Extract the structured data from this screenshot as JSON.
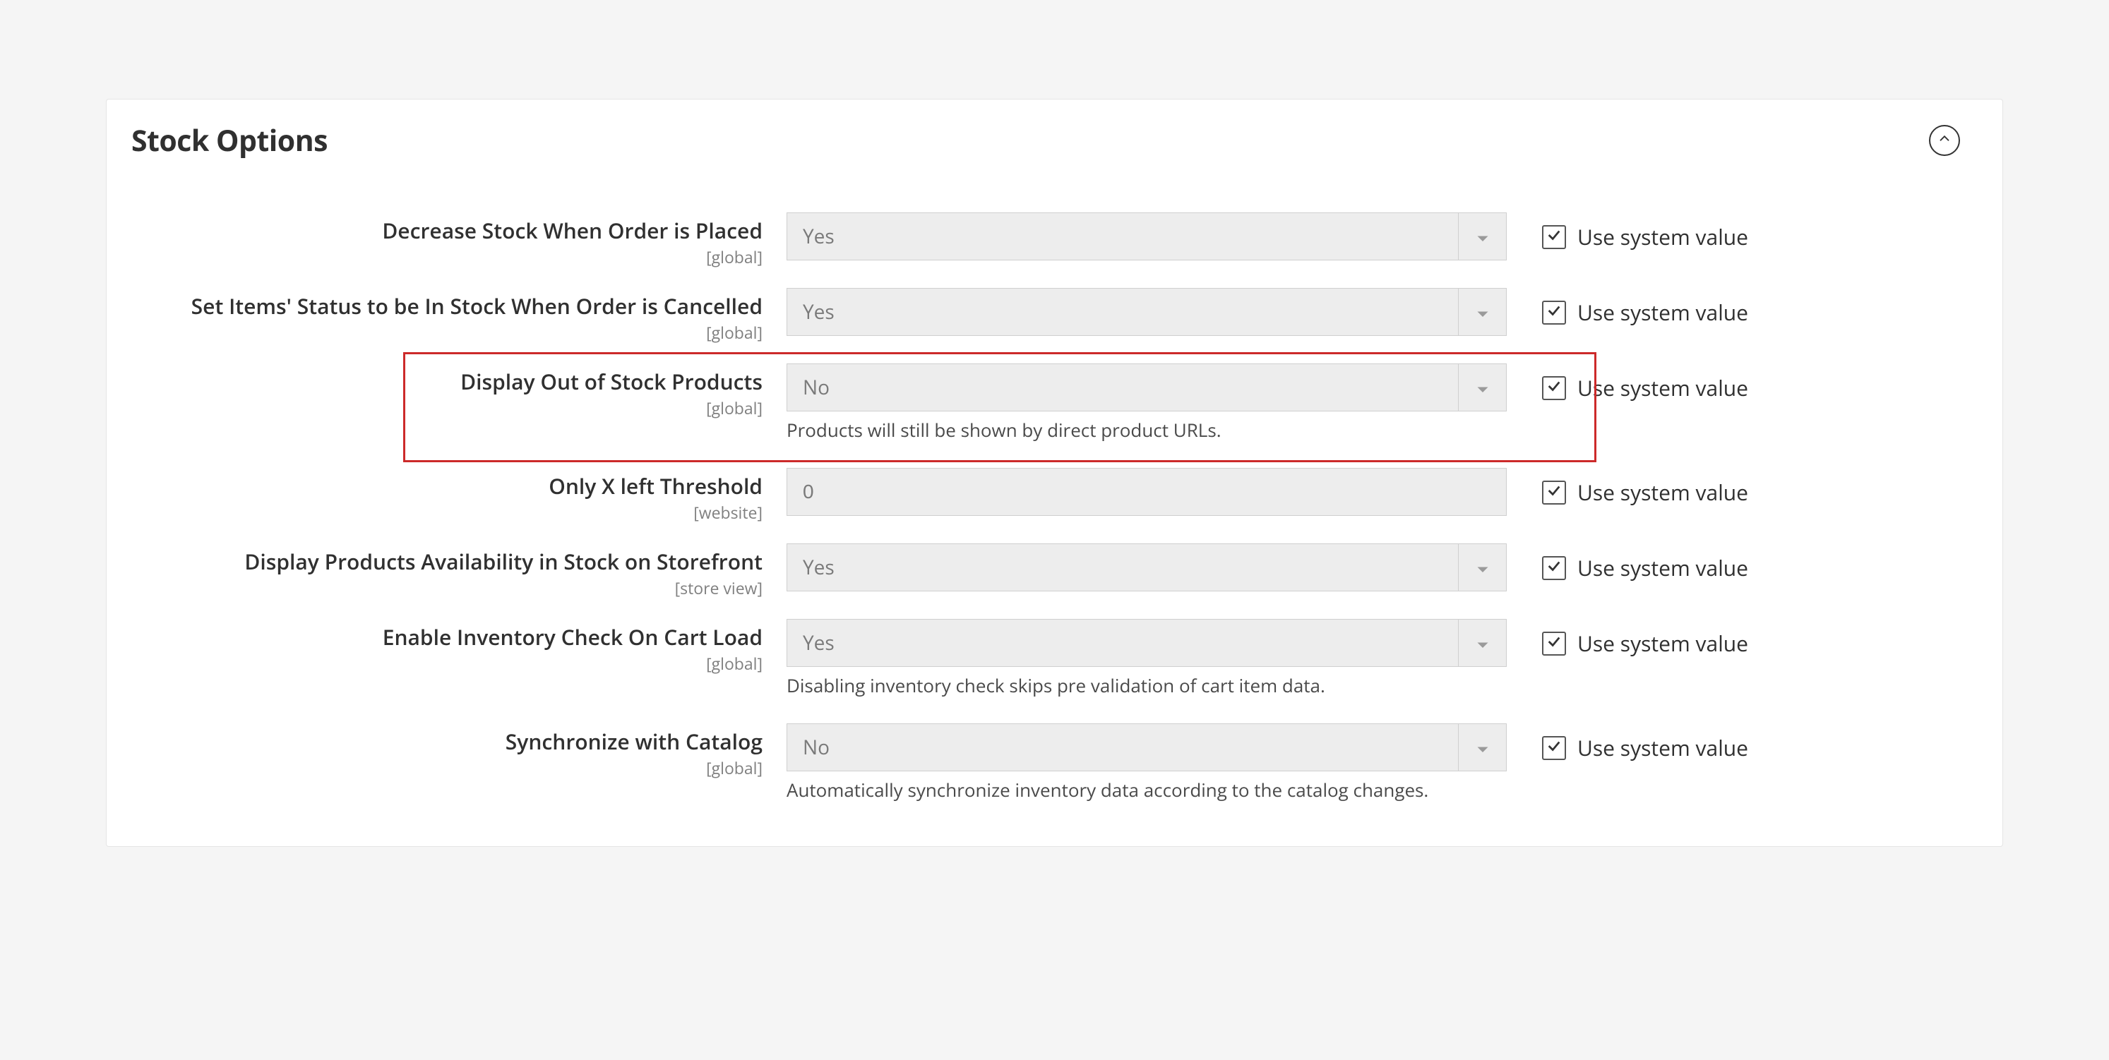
{
  "section": {
    "title": "Stock Options",
    "use_system_label": "Use system value"
  },
  "fields": [
    {
      "label": "Decrease Stock When Order is Placed",
      "scope": "[global]",
      "type": "select",
      "value": "Yes",
      "use_system": true,
      "note": null,
      "highlight": false
    },
    {
      "label": "Set Items' Status to be In Stock When Order is Cancelled",
      "scope": "[global]",
      "type": "select",
      "value": "Yes",
      "use_system": true,
      "note": null,
      "highlight": false
    },
    {
      "label": "Display Out of Stock Products",
      "scope": "[global]",
      "type": "select",
      "value": "No",
      "use_system": true,
      "note": "Products will still be shown by direct product URLs.",
      "highlight": true
    },
    {
      "label": "Only X left Threshold",
      "scope": "[website]",
      "type": "text",
      "value": "0",
      "use_system": true,
      "note": null,
      "highlight": false
    },
    {
      "label": "Display Products Availability in Stock on Storefront",
      "scope": "[store view]",
      "type": "select",
      "value": "Yes",
      "use_system": true,
      "note": null,
      "highlight": false
    },
    {
      "label": "Enable Inventory Check On Cart Load",
      "scope": "[global]",
      "type": "select",
      "value": "Yes",
      "use_system": true,
      "note": "Disabling inventory check skips pre validation of cart item data.",
      "highlight": false
    },
    {
      "label": "Synchronize with Catalog",
      "scope": "[global]",
      "type": "select",
      "value": "No",
      "use_system": true,
      "note": "Automatically synchronize inventory data according to the catalog changes.",
      "highlight": false
    }
  ]
}
